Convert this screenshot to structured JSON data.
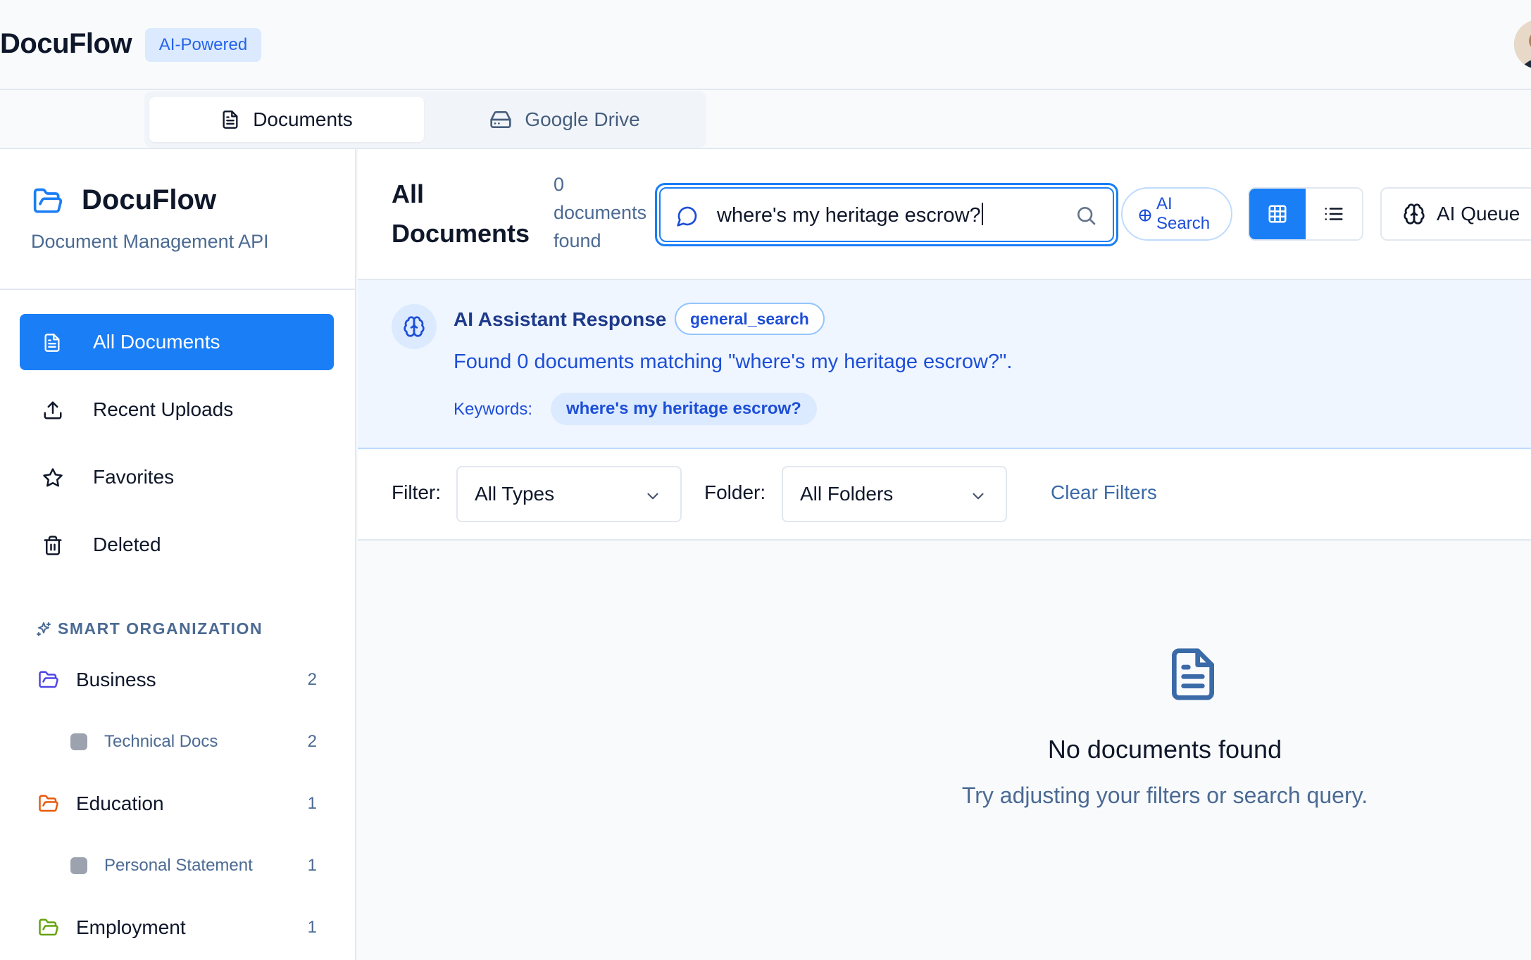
{
  "header": {
    "brand": "DocuFlow",
    "badge": "AI-Powered"
  },
  "tabs": [
    {
      "label": "Documents",
      "icon": "file-text-icon",
      "active": true
    },
    {
      "label": "Google Drive",
      "icon": "hard-drive-icon",
      "active": false
    }
  ],
  "sidebar": {
    "title": "DocuFlow",
    "subtitle": "Document Management API",
    "nav": [
      {
        "label": "All Documents",
        "icon": "file-text-icon",
        "active": true
      },
      {
        "label": "Recent Uploads",
        "icon": "upload-icon",
        "active": false
      },
      {
        "label": "Favorites",
        "icon": "star-icon",
        "active": false
      },
      {
        "label": "Deleted",
        "icon": "trash-icon",
        "active": false
      }
    ],
    "smart_heading": "SMART ORGANIZATION",
    "folders": [
      {
        "label": "Business",
        "count": "2",
        "color": "#4f46e5"
      },
      {
        "label": "Technical Docs",
        "count": "2",
        "sub": true
      },
      {
        "label": "Education",
        "count": "1",
        "color": "#ea580c"
      },
      {
        "label": "Personal Statement",
        "count": "1",
        "sub": true
      },
      {
        "label": "Employment",
        "count": "1",
        "color": "#65a30d"
      }
    ]
  },
  "toolbar": {
    "title": "All Documents",
    "count_text": "0 documents found",
    "search_value": "where's my heritage escrow?",
    "ai_search_label": "AI Search",
    "ai_queue_label": "AI Queue",
    "view_mode": "grid"
  },
  "ai_response": {
    "title": "AI Assistant Response",
    "intent": "general_search",
    "message": "Found 0 documents matching \"where's my heritage escrow?\".",
    "keywords_label": "Keywords:",
    "keywords": [
      "where's my heritage escrow?"
    ]
  },
  "filters": {
    "filter_label": "Filter:",
    "type_value": "All Types",
    "folder_label": "Folder:",
    "folder_value": "All Folders",
    "clear_label": "Clear Filters"
  },
  "empty_state": {
    "title": "No documents found",
    "subtitle": "Try adjusting your filters or search query."
  },
  "colors": {
    "accent": "#1a7ef6",
    "ai_panel_bg": "#eff6ff"
  }
}
